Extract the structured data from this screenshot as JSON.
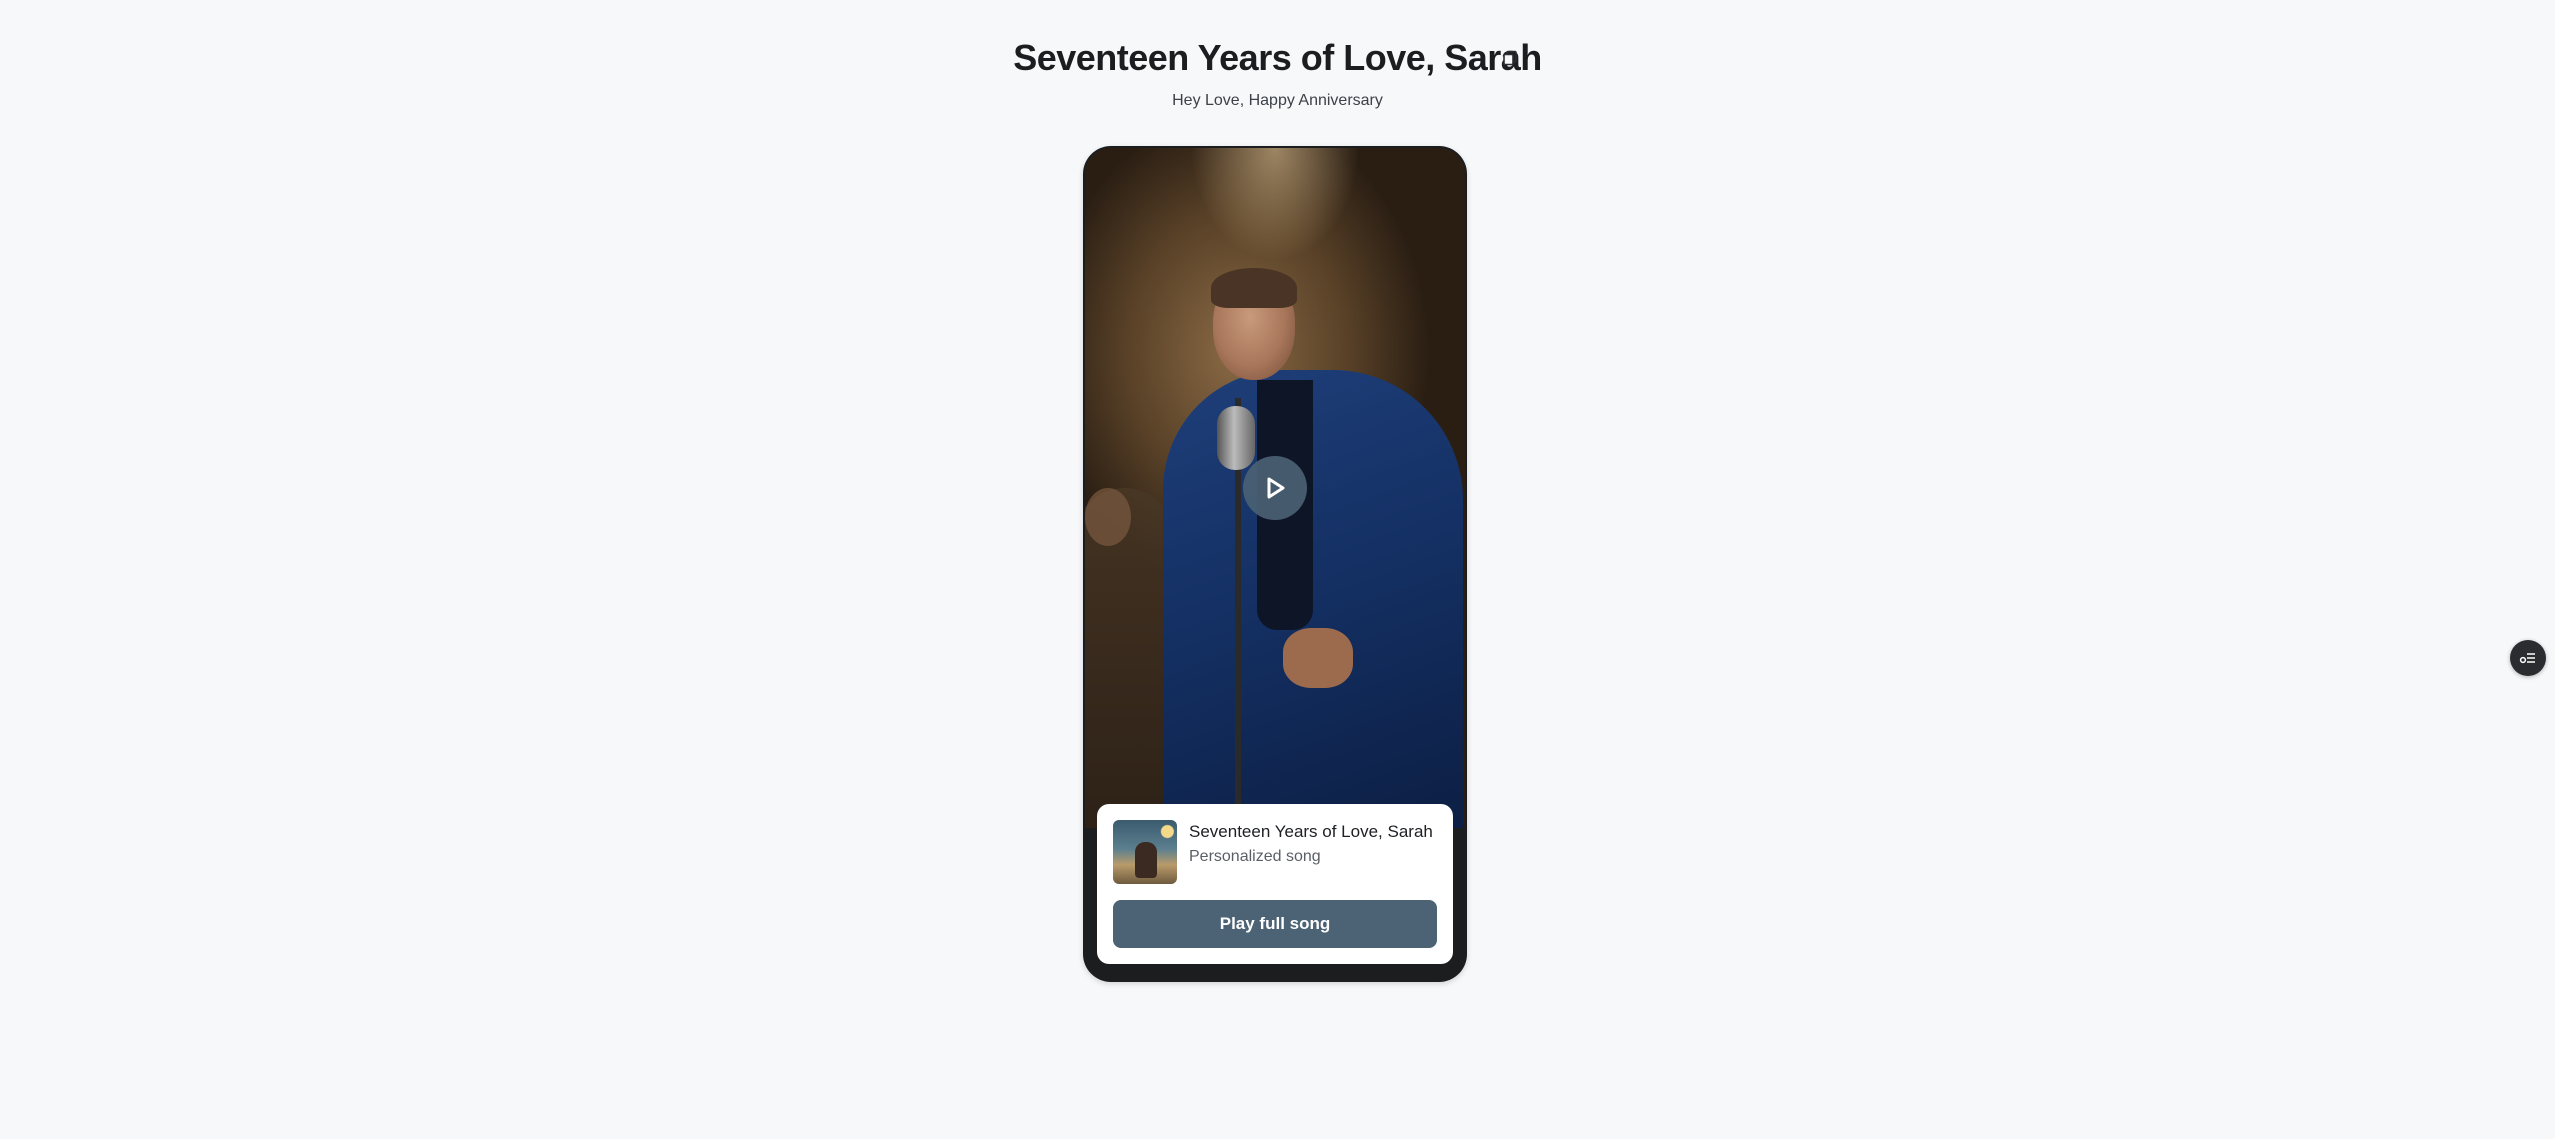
{
  "header": {
    "title": "Seventeen Years of Love, Sarah",
    "subtitle": "Hey Love, Happy Anniversary",
    "copy_icon": "copy-icon"
  },
  "video": {
    "play_icon": "play-icon",
    "scene": "man-singing-into-vintage-microphone"
  },
  "song_card": {
    "title": "Seventeen Years of Love, Sarah",
    "subtitle": "Personalized song",
    "play_button_label": "Play full song",
    "thumbnail": "song-cover-thumbnail"
  },
  "side_widget": {
    "icon": "settings-sliders-icon"
  },
  "colors": {
    "background": "#f7f8fa",
    "accent": "#4b6374",
    "phone_frame": "#1c1d1f"
  }
}
